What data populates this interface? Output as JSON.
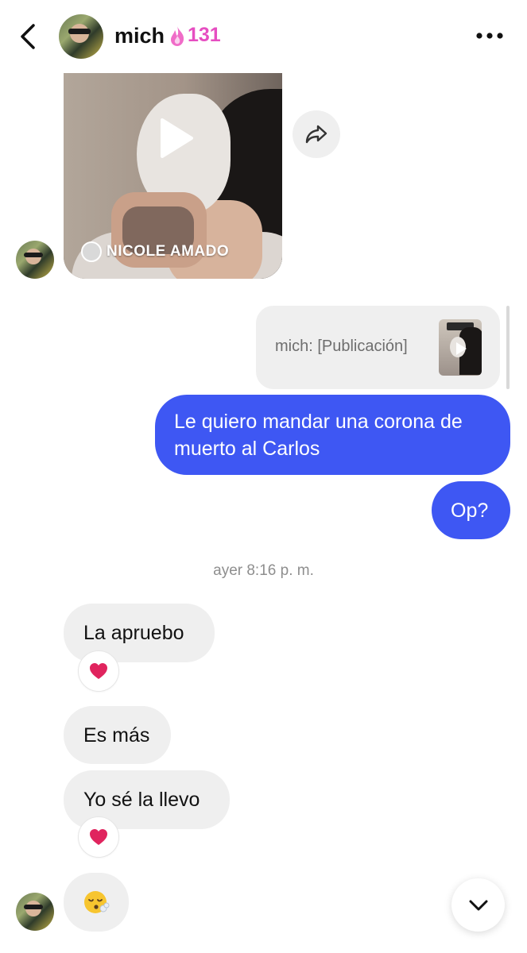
{
  "header": {
    "contact_name": "mich",
    "streak_count": "131",
    "streak_color": "#e64ec1"
  },
  "shared_post": {
    "author": "NICOLE AMADO",
    "media_type": "video"
  },
  "reply_quote": {
    "text": "mich: [Publicación]"
  },
  "messages_out": [
    {
      "text": "Le quiero mandar una corona de muerto al Carlos"
    },
    {
      "text": "Op?"
    }
  ],
  "timestamp": "ayer 8:16 p. m.",
  "messages_in": [
    {
      "text": "La apruebo",
      "reaction": "heart"
    },
    {
      "text": "Es más"
    },
    {
      "text": "Yo sé la llevo",
      "reaction": "heart"
    },
    {
      "emoji": "face-exhaling"
    }
  ],
  "colors": {
    "outgoing_bubble": "#3e57f3",
    "incoming_bubble": "#efefef",
    "heart": "#e0245e"
  }
}
